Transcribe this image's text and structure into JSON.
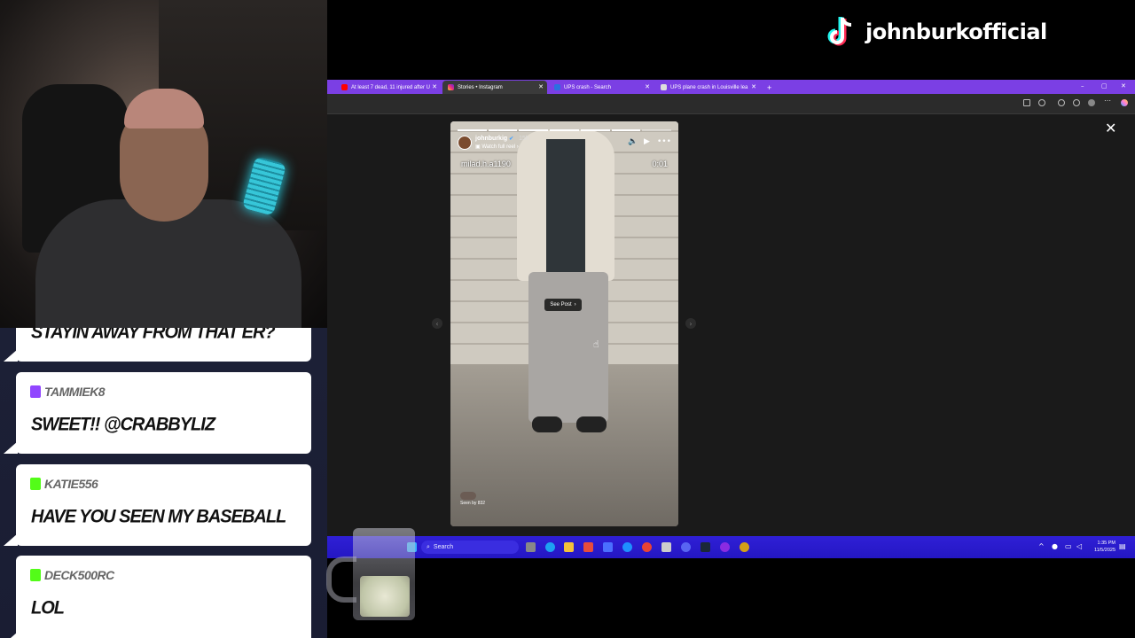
{
  "tiktok": {
    "handle": "johnburkofficial",
    "icon": "tiktok-logo"
  },
  "chat": [
    {
      "user": "",
      "badge": "none",
      "message": "STAYIN AWAY FROM THAT ER?"
    },
    {
      "user": "TAMMIEK8",
      "badge": "twitch",
      "message": "SWEET!! @CRABBYLIZ"
    },
    {
      "user": "KATIE556",
      "badge": "kick",
      "message": "HAVE YOU SEEN MY BASEBALL"
    },
    {
      "user": "DECK500RC",
      "badge": "kick",
      "message": "LOL"
    }
  ],
  "browser": {
    "tabs": [
      {
        "label": "At least 7 dead, 11 injured after U",
        "icon": "youtube-icon",
        "active": false
      },
      {
        "label": "Stories • Instagram",
        "icon": "instagram-icon",
        "active": true
      },
      {
        "label": "UPS crash - Search",
        "icon": "search-icon",
        "active": false
      },
      {
        "label": "UPS plane crash in Louisville lea",
        "icon": "news-icon",
        "active": false
      }
    ],
    "new_tab": "+",
    "window_controls": [
      "–",
      "▢",
      "✕"
    ]
  },
  "story": {
    "username": "johnburkig",
    "posted": "15h",
    "watch_full_reel": "Watch full reel",
    "tag": "milad.h.a1190",
    "duration": "0:01",
    "see_post": "See Post",
    "seen_by": "Seen by 832",
    "close": "✕",
    "prev": "‹",
    "next": "›"
  },
  "taskbar": {
    "search_placeholder": "Search",
    "time": "1:35 PM",
    "date": "11/5/2025"
  }
}
